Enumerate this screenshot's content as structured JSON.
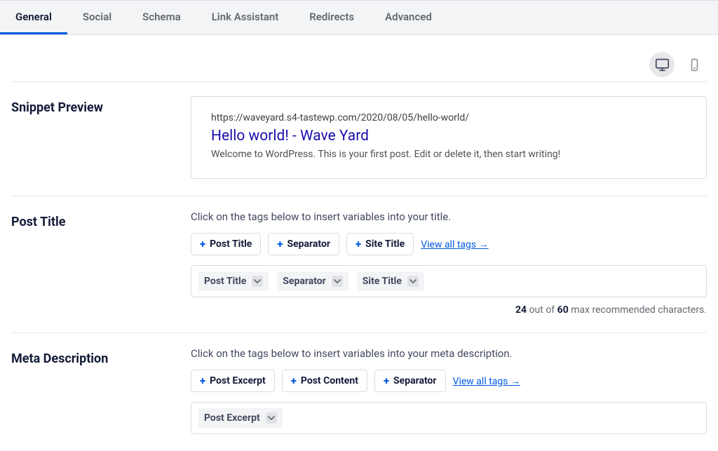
{
  "tabs": [
    "General",
    "Social",
    "Schema",
    "Link Assistant",
    "Redirects",
    "Advanced"
  ],
  "active_tab": 0,
  "snippet": {
    "section_label": "Snippet Preview",
    "url": "https://waveyard.s4-tastewp.com/2020/08/05/hello-world/",
    "title": "Hello world! - Wave Yard",
    "description": "Welcome to WordPress. This is your first post. Edit or delete it, then start writing!"
  },
  "post_title": {
    "section_label": "Post Title",
    "hint": "Click on the tags below to insert variables into your title.",
    "tag_buttons": [
      "Post Title",
      "Separator",
      "Site Title"
    ],
    "view_all": "View all tags →",
    "chips": [
      "Post Title",
      "Separator",
      "Site Title"
    ],
    "counter": {
      "current": 24,
      "max": 60,
      "mid": " out of ",
      "suffix": " max recommended characters."
    }
  },
  "meta_description": {
    "section_label": "Meta Description",
    "hint": "Click on the tags below to insert variables into your meta description.",
    "tag_buttons": [
      "Post Excerpt",
      "Post Content",
      "Separator"
    ],
    "view_all": "View all tags →",
    "chips": [
      "Post Excerpt"
    ]
  }
}
